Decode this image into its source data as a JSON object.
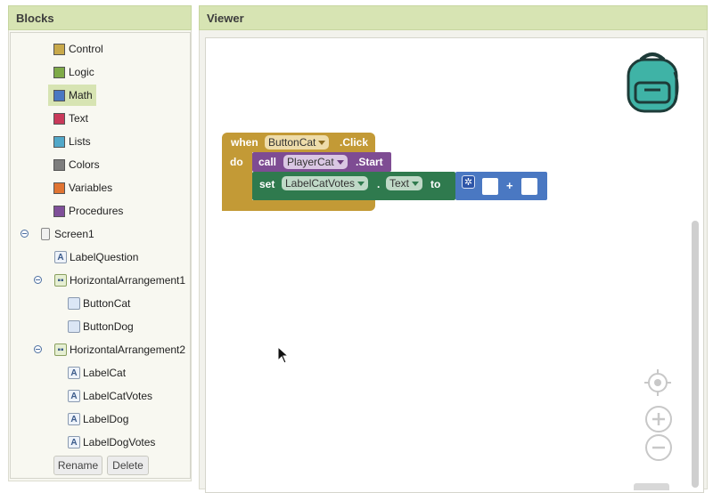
{
  "blocks_panel": {
    "title": "Blocks",
    "builtin": [
      {
        "label": "Control",
        "color": "#c8a94b"
      },
      {
        "label": "Logic",
        "color": "#7eaa48"
      },
      {
        "label": "Math",
        "color": "#4a78c2"
      },
      {
        "label": "Text",
        "color": "#c9395a"
      },
      {
        "label": "Lists",
        "color": "#52a8c9"
      },
      {
        "label": "Colors",
        "color": "#7d7d7d"
      },
      {
        "label": "Variables",
        "color": "#e07432"
      },
      {
        "label": "Procedures",
        "color": "#7f4f99"
      }
    ],
    "components": {
      "screen": "Screen1",
      "label_question": "LabelQuestion",
      "h1": "HorizontalArrangement1",
      "button_cat": "ButtonCat",
      "button_dog": "ButtonDog",
      "h2": "HorizontalArrangement2",
      "label_cat": "LabelCat",
      "label_cat_votes": "LabelCatVotes",
      "label_dog": "LabelDog",
      "label_dog_votes": "LabelDogVotes"
    },
    "rename_label": "Rename",
    "delete_label": "Delete"
  },
  "viewer": {
    "title": "Viewer",
    "event_block": {
      "when": "when",
      "component": "ButtonCat",
      "event": ".Click",
      "do": "do",
      "color": "#c39a36"
    },
    "call_block": {
      "call": "call",
      "component": "PlayerCat",
      "method": ".Start",
      "color": "#7e4c93"
    },
    "set_block": {
      "set": "set",
      "component": "LabelCatVotes",
      "dot": ".",
      "property": "Text",
      "to": "to",
      "color": "#2f7a4e"
    },
    "math_block": {
      "operator": "+",
      "color": "#4a78c2"
    }
  }
}
